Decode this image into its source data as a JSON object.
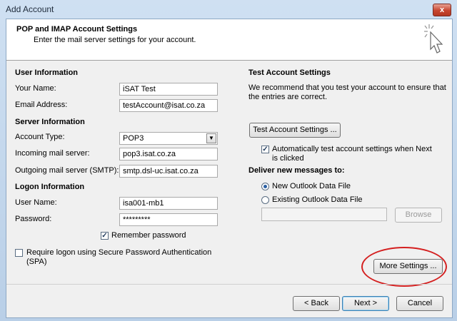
{
  "window": {
    "title": "Add Account",
    "close_label": "x"
  },
  "header": {
    "title": "POP and IMAP Account Settings",
    "subtitle": "Enter the mail server settings for your account."
  },
  "user_info": {
    "section": "User Information",
    "name_label": "Your Name:",
    "name_value": "iSAT Test",
    "email_label": "Email Address:",
    "email_value": "testAccount@isat.co.za"
  },
  "server_info": {
    "section": "Server Information",
    "account_type_label": "Account Type:",
    "account_type_value": "POP3",
    "incoming_label": "Incoming mail server:",
    "incoming_value": "pop3.isat.co.za",
    "outgoing_label": "Outgoing mail server (SMTP):",
    "outgoing_value": "smtp.dsl-uc.isat.co.za"
  },
  "logon_info": {
    "section": "Logon Information",
    "username_label": "User Name:",
    "username_value": "isa001-mb1",
    "password_label": "Password:",
    "password_value": "*********",
    "remember_label": "Remember password",
    "remember_checked": true,
    "spa_label_1": "Require logon using Secure Password Authentication",
    "spa_label_2": "(SPA)",
    "spa_checked": false
  },
  "test_settings": {
    "section": "Test Account Settings",
    "desc_1": "We recommend that you test your account to ensure that",
    "desc_2": "the entries are correct.",
    "test_button": "Test Account Settings ...",
    "auto_test_label_1": "Automatically test account settings when Next",
    "auto_test_label_2": "is clicked",
    "auto_test_checked": true
  },
  "delivery": {
    "section": "Deliver new messages to:",
    "new_file_label": "New Outlook Data File",
    "existing_file_label": "Existing Outlook Data File",
    "selected": "new",
    "browse_button": "Browse"
  },
  "more_settings_button": "More Settings ...",
  "footer": {
    "back": "< Back",
    "next": "Next >",
    "cancel": "Cancel"
  },
  "colors": {
    "annotation": "#d42020",
    "accent": "#2a5fa3"
  }
}
